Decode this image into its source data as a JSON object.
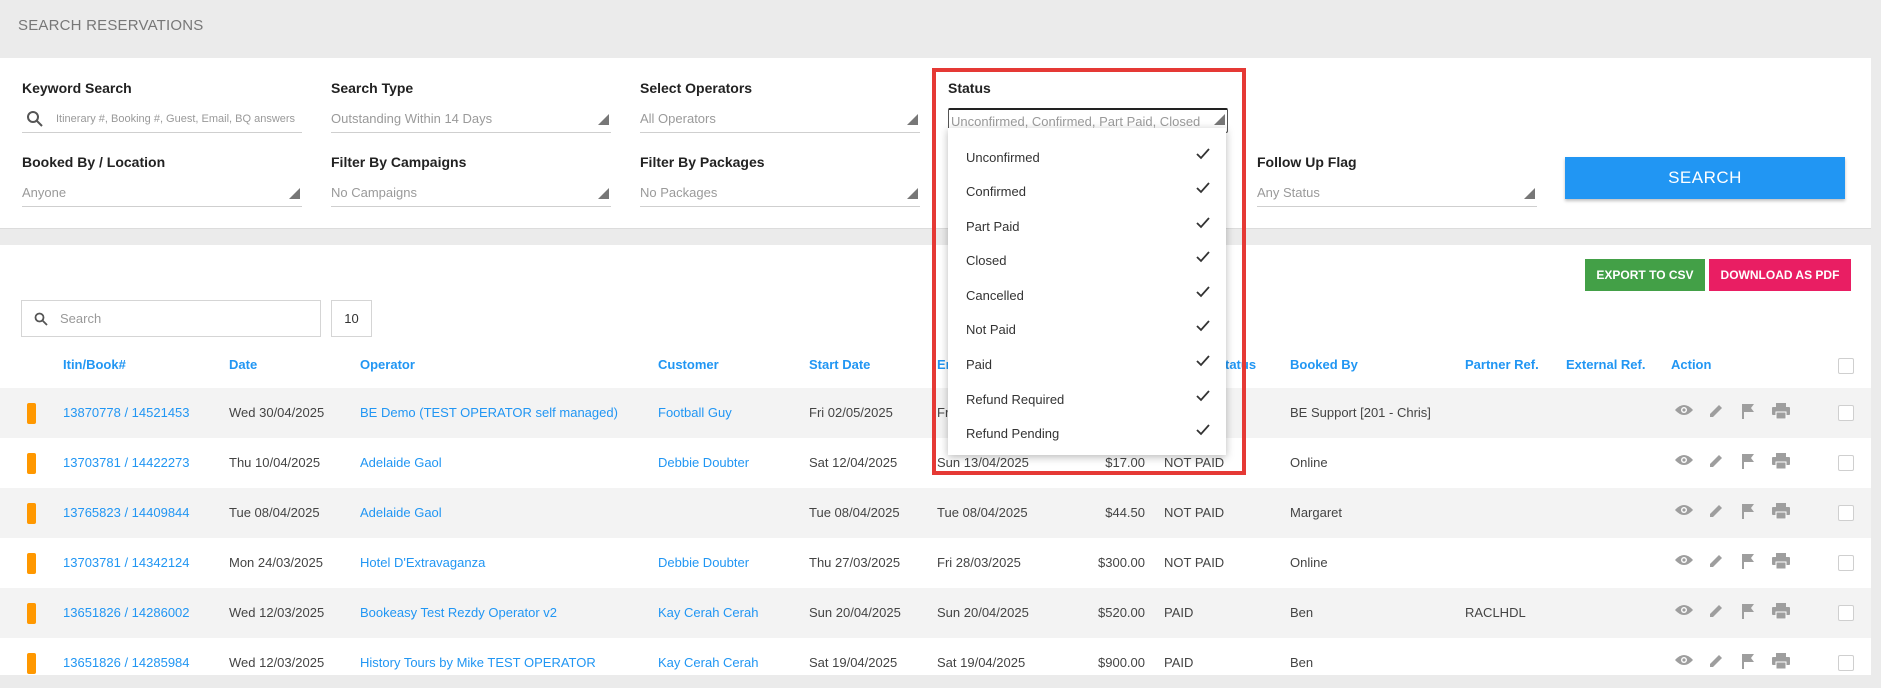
{
  "page_title": "SEARCH RESERVATIONS",
  "filters": {
    "keyword": {
      "label": "Keyword Search",
      "placeholder": "Itinerary #, Booking #, Guest, Email, BQ answers"
    },
    "search_type": {
      "label": "Search Type",
      "value": "Outstanding Within 14 Days"
    },
    "operators": {
      "label": "Select Operators",
      "value": "All Operators"
    },
    "status": {
      "label": "Status",
      "value": "Unconfirmed, Confirmed, Part Paid, Closed"
    },
    "booked_by": {
      "label": "Booked By / Location",
      "value": "Anyone"
    },
    "campaigns": {
      "label": "Filter By Campaigns",
      "value": "No Campaigns"
    },
    "packages": {
      "label": "Filter By Packages",
      "value": "No Packages"
    },
    "follow_up": {
      "label": "Follow Up Flag",
      "value": "Any Status"
    },
    "search_button": "SEARCH"
  },
  "status_dropdown": {
    "options": [
      {
        "label": "Unconfirmed",
        "checked": true
      },
      {
        "label": "Confirmed",
        "checked": true
      },
      {
        "label": "Part Paid",
        "checked": true
      },
      {
        "label": "Closed",
        "checked": true
      },
      {
        "label": "Cancelled",
        "checked": true
      },
      {
        "label": "Not Paid",
        "checked": true
      },
      {
        "label": "Paid",
        "checked": true
      },
      {
        "label": "Refund Required",
        "checked": true
      },
      {
        "label": "Refund Pending",
        "checked": true
      }
    ]
  },
  "toolbar": {
    "export_csv": "EXPORT TO CSV",
    "download_pdf": "DOWNLOAD AS PDF",
    "search_placeholder": "Search",
    "page_size": "10"
  },
  "table": {
    "columns": {
      "itin": "Itin/Book#",
      "date": "Date",
      "operator": "Operator",
      "customer": "Customer",
      "start": "Start Date",
      "end": "Er",
      "status": "tatus",
      "booked_by": "Booked By",
      "partner": "Partner Ref.",
      "external": "External Ref.",
      "action": "Action"
    },
    "rows": [
      {
        "itin": "13870778 / 14521453",
        "date": "Wed 30/04/2025",
        "operator": "BE Demo (TEST OPERATOR self managed)",
        "customer": "Football Guy",
        "start": "Fri 02/05/2025",
        "end": "Fr",
        "amount": "",
        "status": "",
        "booked_by": "BE Support [201 - Chris]",
        "partner": ""
      },
      {
        "itin": "13703781 / 14422273",
        "date": "Thu 10/04/2025",
        "operator": "Adelaide Gaol",
        "customer": "Debbie Doubter",
        "start": "Sat 12/04/2025",
        "end": "Sun 13/04/2025",
        "amount": "$17.00",
        "status": "NOT PAID",
        "booked_by": "Online",
        "partner": ""
      },
      {
        "itin": "13765823 / 14409844",
        "date": "Tue 08/04/2025",
        "operator": "Adelaide Gaol",
        "customer": "",
        "start": "Tue 08/04/2025",
        "end": "Tue 08/04/2025",
        "amount": "$44.50",
        "status": "NOT PAID",
        "booked_by": "Margaret",
        "partner": ""
      },
      {
        "itin": "13703781 / 14342124",
        "date": "Mon 24/03/2025",
        "operator": "Hotel D'Extravaganza",
        "customer": "Debbie Doubter",
        "start": "Thu 27/03/2025",
        "end": "Fri 28/03/2025",
        "amount": "$300.00",
        "status": "NOT PAID",
        "booked_by": "Online",
        "partner": ""
      },
      {
        "itin": "13651826 / 14286002",
        "date": "Wed 12/03/2025",
        "operator": "Bookeasy Test Rezdy Operator v2",
        "customer": "Kay Cerah Cerah",
        "start": "Sun 20/04/2025",
        "end": "Sun 20/04/2025",
        "amount": "$520.00",
        "status": "PAID",
        "booked_by": "Ben",
        "partner": "RACLHDL"
      },
      {
        "itin": "13651826 / 14285984",
        "date": "Wed 12/03/2025",
        "operator": "History Tours by Mike TEST OPERATOR",
        "customer": "Kay Cerah Cerah",
        "start": "Sat 19/04/2025",
        "end": "Sat 19/04/2025",
        "amount": "$900.00",
        "status": "PAID",
        "booked_by": "Ben",
        "partner": ""
      }
    ]
  },
  "colors": {
    "accent": "#2196f3",
    "csv": "#43a047",
    "pdf": "#e91e63",
    "flag": "#ff9800",
    "highlight": "#e53935"
  }
}
